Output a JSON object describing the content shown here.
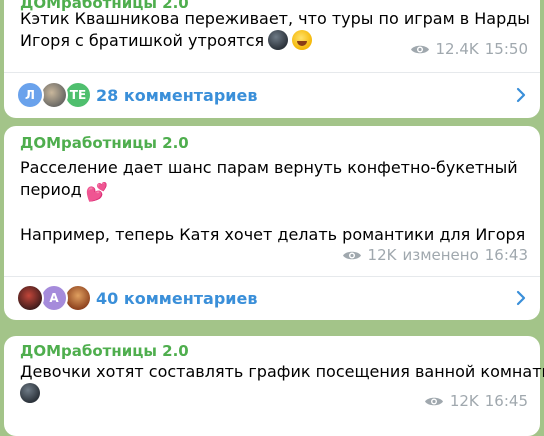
{
  "posts": [
    {
      "channel": "ДОМработницы 2.0",
      "lines": [
        "Кэтик Квашникова переживает, что туры по играм в Нарды",
        "Игоря с братишкой утроятся"
      ],
      "views": "12.4K",
      "edited": "",
      "time": "15:50",
      "comments_label": "28 комментариев",
      "avatars": [
        {
          "text": "Л",
          "color": "#6aa2ec"
        },
        {
          "text": "",
          "color": "#8c8f8a"
        },
        {
          "text": "TE",
          "color": "#4fbf6e"
        }
      ]
    },
    {
      "channel": "ДОМработницы 2.0",
      "lines": [
        "Расселение дает шанс парам вернуть конфетно-букетный",
        "период",
        "",
        "Например, теперь Катя хочет делать романтики для Игоря"
      ],
      "views": "12K",
      "edited": "изменено",
      "time": "16:43",
      "comments_label": "40 комментариев",
      "avatars": [
        {
          "text": "",
          "color": "#7b2a24"
        },
        {
          "text": "А",
          "color": "#a58bdb"
        },
        {
          "text": "",
          "color": "#b86a2e"
        }
      ]
    },
    {
      "channel": "ДОМработницы 2.0",
      "lines": [
        "Девочки хотят составлять график посещения ванной комнаты"
      ],
      "views": "12K",
      "edited": "",
      "time": "16:45"
    }
  ],
  "colors": {
    "background": "#a3c489",
    "channel_name": "#4fae4e",
    "link": "#3a8fd9",
    "meta": "#a0a8ae"
  }
}
